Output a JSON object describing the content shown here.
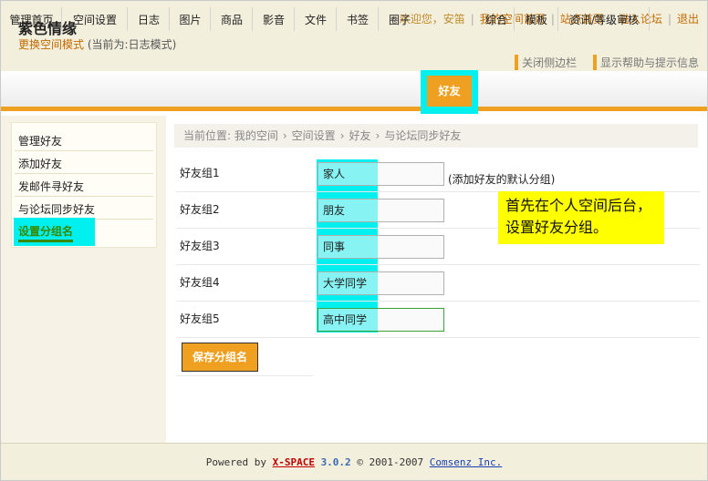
{
  "header": {
    "title": "紫色情缘",
    "mode_link": "更换空间模式",
    "mode_current": "(当前为:日志模式)",
    "welcome": "欢迎您，安笛",
    "links": [
      "我的空间首页",
      "站点首页",
      "进入论坛",
      "退出"
    ],
    "toggles": [
      "关闭侧边栏",
      "显示帮助与提示信息"
    ]
  },
  "nav": {
    "items": [
      "管理首页",
      "空间设置",
      "日志",
      "图片",
      "商品",
      "影音",
      "文件",
      "书签",
      "圈子",
      "好友",
      "综合",
      "模板",
      "资讯/等级审核"
    ],
    "active": "好友"
  },
  "sidebar": {
    "items": [
      "管理好友",
      "添加好友",
      "发邮件寻好友",
      "与论坛同步好友",
      "设置分组名"
    ],
    "active": "设置分组名"
  },
  "breadcrumb": [
    "当前位置: 我的空间",
    "空间设置",
    "好友",
    "与论坛同步好友"
  ],
  "groups": [
    {
      "label": "好友组1",
      "value": "家人"
    },
    {
      "label": "好友组2",
      "value": "朋友"
    },
    {
      "label": "好友组3",
      "value": "同事"
    },
    {
      "label": "好友组4",
      "value": "大学同学"
    },
    {
      "label": "好友组5",
      "value": "高中同学"
    }
  ],
  "default_hint": "(添加好友的默认分组)",
  "annotation": "首先在个人空间后台，设置好友分组。",
  "save_label": "保存分组名",
  "footer": {
    "powered": "Powered by",
    "brand": "X-SPACE",
    "version": "3.0.2",
    "copyright": "© 2001-2007",
    "company": "Comsenz Inc."
  },
  "colors": {
    "accent": "#f0a020",
    "highlight": "#00f0f0",
    "note": "#ffff00",
    "active_green": "#3a8a00"
  }
}
